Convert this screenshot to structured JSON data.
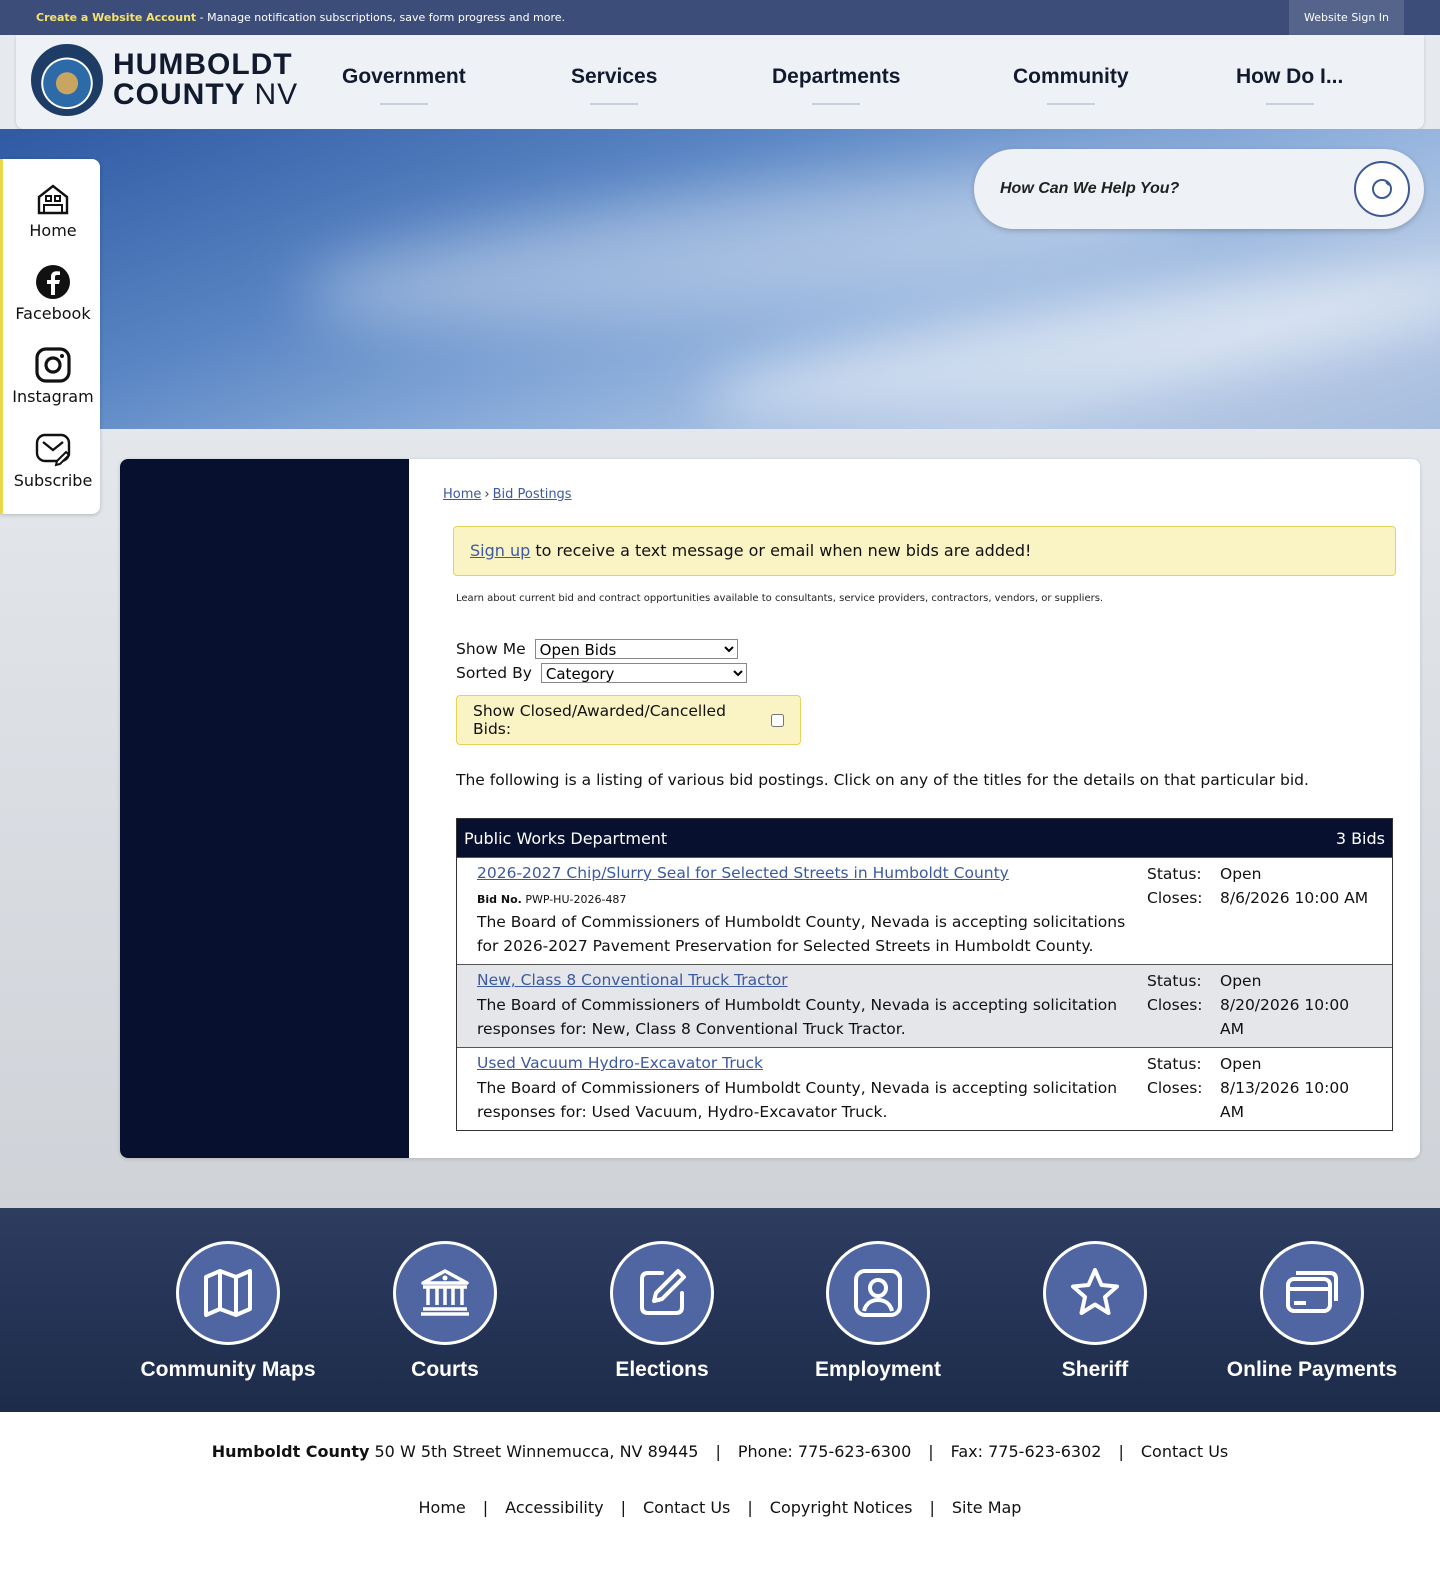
{
  "topbar": {
    "account_link": "Create a Website Account",
    "account_msg": " - Manage notification subscriptions, save form progress and more.",
    "signin": "Website Sign In"
  },
  "logo": {
    "line1": "HUMBOLDT",
    "line2": "COUNTY",
    "line2_suffix": "NV"
  },
  "nav": [
    "Government",
    "Services",
    "Departments",
    "Community",
    "How Do I..."
  ],
  "search": {
    "placeholder": "How Can We Help You?"
  },
  "social": [
    "Home",
    "Facebook",
    "Instagram",
    "Subscribe"
  ],
  "breadcrumb": {
    "home": "Home",
    "sep": "›",
    "current": "Bid Postings"
  },
  "alert": {
    "link": "Sign up",
    "text": " to receive a text message or email when new bids are added!"
  },
  "intro": "Learn about current bid and contract opportunities available to consultants, service providers, contractors, vendors, or suppliers.",
  "filters": {
    "show_me_label": "Show Me",
    "show_me_value": "Open Bids",
    "sorted_by_label": "Sorted By",
    "sorted_by_value": "Category",
    "show_closed_label": "Show Closed/Awarded/Cancelled Bids:"
  },
  "listing_text": "The following is a listing of various bid postings. Click on any of the titles for the details on that particular bid.",
  "bid_group": {
    "department": "Public Works Department",
    "count": "3 Bids",
    "bids": [
      {
        "title": "2026-2027 Chip/Slurry Seal for Selected Streets in Humboldt County",
        "bid_no_label": "Bid No.",
        "bid_no": "PWP-HU-2026-487",
        "description": "The Board of Commissioners of Humboldt County, Nevada is accepting solicitations for 2026-2027 Pavement Preservation for Selected Streets in Humboldt County.",
        "status_label": "Status:",
        "status": "Open",
        "closes_label": "Closes:",
        "closes": "8/6/2026 10:00 AM"
      },
      {
        "title": "New, Class 8 Conventional Truck Tractor",
        "description": "The Board of Commissioners of Humboldt County, Nevada is accepting solicitation responses for: New, Class 8 Conventional Truck Tractor.",
        "status_label": "Status:",
        "status": "Open",
        "closes_label": "Closes:",
        "closes": "8/20/2026 10:00 AM"
      },
      {
        "title": "Used Vacuum Hydro-Excavator Truck",
        "description": "The Board of Commissioners of Humboldt County, Nevada is accepting solicitation responses for: Used Vacuum, Hydro-Excavator Truck.",
        "status_label": "Status:",
        "status": "Open",
        "closes_label": "Closes:",
        "closes": "8/13/2026 10:00 AM"
      }
    ]
  },
  "quick_links": [
    {
      "label": "Community Maps",
      "icon": "map-icon"
    },
    {
      "label": "Courts",
      "icon": "courthouse-icon"
    },
    {
      "label": "Elections",
      "icon": "edit-icon"
    },
    {
      "label": "Employment",
      "icon": "person-icon"
    },
    {
      "label": "Sheriff",
      "icon": "star-icon"
    },
    {
      "label": "Online Payments",
      "icon": "card-icon"
    }
  ],
  "footer": {
    "org": "Humboldt County",
    "address": "50 W 5th Street Winnemucca, NV 89445",
    "phone": "Phone: 775-623-6300",
    "fax": "Fax: 775-623-6302",
    "contact": "Contact Us",
    "sep": "|",
    "links": [
      "Home",
      "Accessibility",
      "Contact Us",
      "Copyright Notices",
      "Site Map"
    ]
  },
  "colors": {
    "navy": "#07112f",
    "link": "#3c5aa0",
    "alert_bg": "#faf3c4",
    "accent_yellow": "#f5e26a"
  }
}
